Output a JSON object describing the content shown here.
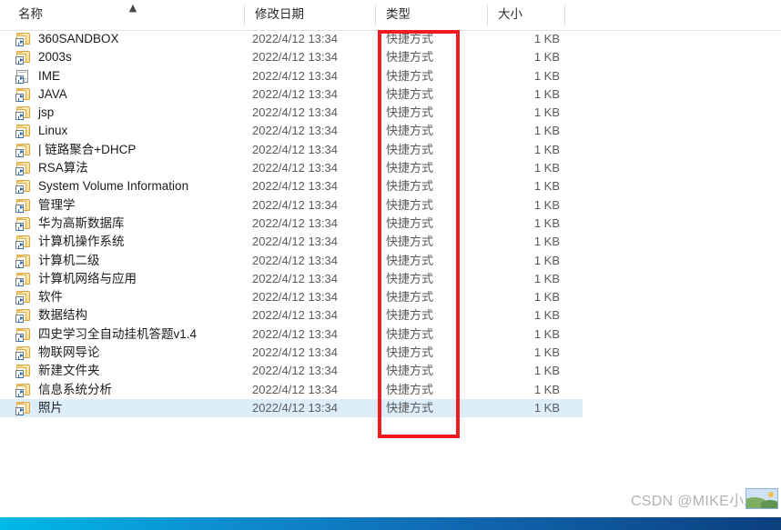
{
  "window": {
    "app": "Windows File Explorer",
    "view_mode": "details"
  },
  "columns": {
    "name": "名称",
    "date_modified": "修改日期",
    "type": "类型",
    "size": "大小",
    "sort_indicator": "▲",
    "sorted_by": "名称",
    "sort_direction": "ascending"
  },
  "files": [
    {
      "name": "360SANDBOX",
      "date": "2022/4/12 13:34",
      "type": "快捷方式",
      "size": "1 KB",
      "icon": "folder-shortcut-icon",
      "selected": false
    },
    {
      "name": "2003s",
      "date": "2022/4/12 13:34",
      "type": "快捷方式",
      "size": "1 KB",
      "icon": "folder-shortcut-icon",
      "selected": false
    },
    {
      "name": "IME",
      "date": "2022/4/12 13:34",
      "type": "快捷方式",
      "size": "1 KB",
      "icon": "document-shortcut-icon",
      "selected": false
    },
    {
      "name": "JAVA",
      "date": "2022/4/12 13:34",
      "type": "快捷方式",
      "size": "1 KB",
      "icon": "folder-shortcut-icon",
      "selected": false
    },
    {
      "name": "jsp",
      "date": "2022/4/12 13:34",
      "type": "快捷方式",
      "size": "1 KB",
      "icon": "folder-shortcut-icon",
      "selected": false
    },
    {
      "name": "Linux",
      "date": "2022/4/12 13:34",
      "type": "快捷方式",
      "size": "1 KB",
      "icon": "folder-shortcut-icon",
      "selected": false
    },
    {
      "name": "| 链路聚合+DHCP",
      "date": "2022/4/12 13:34",
      "type": "快捷方式",
      "size": "1 KB",
      "icon": "folder-shortcut-icon",
      "selected": false
    },
    {
      "name": "RSA算法",
      "date": "2022/4/12 13:34",
      "type": "快捷方式",
      "size": "1 KB",
      "icon": "folder-shortcut-icon",
      "selected": false
    },
    {
      "name": "System Volume Information",
      "date": "2022/4/12 13:34",
      "type": "快捷方式",
      "size": "1 KB",
      "icon": "folder-shortcut-icon",
      "selected": false
    },
    {
      "name": "管理学",
      "date": "2022/4/12 13:34",
      "type": "快捷方式",
      "size": "1 KB",
      "icon": "folder-shortcut-icon",
      "selected": false
    },
    {
      "name": "华为高斯数据库",
      "date": "2022/4/12 13:34",
      "type": "快捷方式",
      "size": "1 KB",
      "icon": "folder-shortcut-icon",
      "selected": false
    },
    {
      "name": "计算机操作系统",
      "date": "2022/4/12 13:34",
      "type": "快捷方式",
      "size": "1 KB",
      "icon": "folder-shortcut-icon",
      "selected": false
    },
    {
      "name": "计算机二级",
      "date": "2022/4/12 13:34",
      "type": "快捷方式",
      "size": "1 KB",
      "icon": "folder-shortcut-icon",
      "selected": false
    },
    {
      "name": "计算机网络与应用",
      "date": "2022/4/12 13:34",
      "type": "快捷方式",
      "size": "1 KB",
      "icon": "folder-shortcut-icon",
      "selected": false
    },
    {
      "name": "软件",
      "date": "2022/4/12 13:34",
      "type": "快捷方式",
      "size": "1 KB",
      "icon": "folder-shortcut-icon",
      "selected": false
    },
    {
      "name": "数据结构",
      "date": "2022/4/12 13:34",
      "type": "快捷方式",
      "size": "1 KB",
      "icon": "folder-shortcut-icon",
      "selected": false
    },
    {
      "name": "四史学习全自动挂机答题v1.4",
      "date": "2022/4/12 13:34",
      "type": "快捷方式",
      "size": "1 KB",
      "icon": "folder-shortcut-icon",
      "selected": false
    },
    {
      "name": "物联网导论",
      "date": "2022/4/12 13:34",
      "type": "快捷方式",
      "size": "1 KB",
      "icon": "folder-shortcut-icon",
      "selected": false
    },
    {
      "name": "新建文件夹",
      "date": "2022/4/12 13:34",
      "type": "快捷方式",
      "size": "1 KB",
      "icon": "folder-shortcut-icon",
      "selected": false
    },
    {
      "name": "信息系统分析",
      "date": "2022/4/12 13:34",
      "type": "快捷方式",
      "size": "1 KB",
      "icon": "folder-shortcut-icon",
      "selected": false
    },
    {
      "name": "照片",
      "date": "2022/4/12 13:34",
      "type": "快捷方式",
      "size": "1 KB",
      "icon": "folder-shortcut-icon",
      "selected": true
    }
  ],
  "annotation": {
    "shape": "rectangle",
    "color": "#ef1b20",
    "target_column": "类型"
  },
  "watermark": {
    "text": "CSDN @MIKE小助手",
    "color": "#b3b3b3"
  },
  "colors": {
    "selection": "#ddeefb",
    "annotation_red": "#ef1b20",
    "folder_yellow": "#fcdc8d",
    "taskbar_left": "#00b9e8",
    "taskbar_right": "#0b3f7e"
  }
}
